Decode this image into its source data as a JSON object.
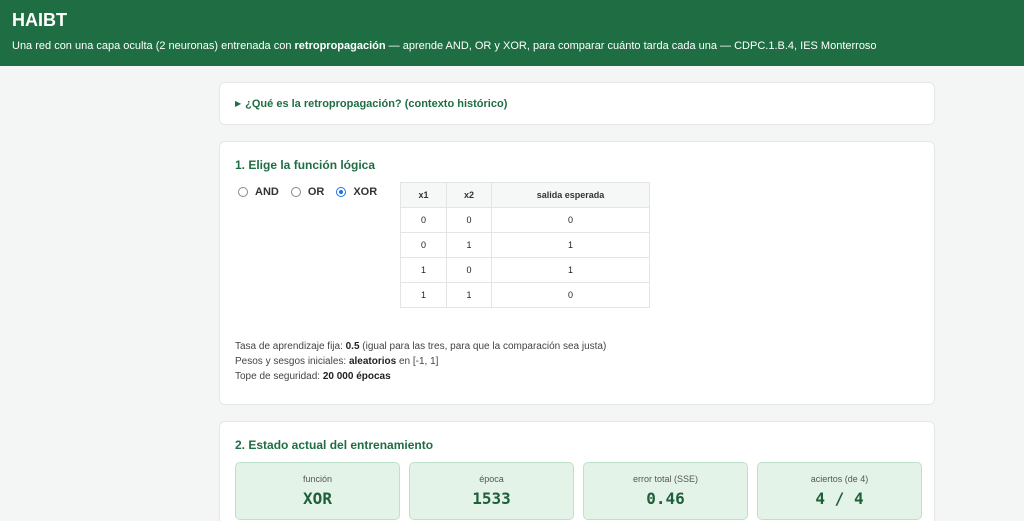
{
  "header": {
    "title": "HAIBT",
    "subtitle_pre": "Una red con una capa oculta (2 neuronas) entrenada con ",
    "subtitle_bold": "retropropagación",
    "subtitle_post": " — aprende AND, OR y XOR, para comparar cuánto tarda cada una — CDPC.1.B.4, IES Monterroso"
  },
  "context": {
    "summary": "¿Qué es la retropropagación? (contexto histórico)"
  },
  "section1": {
    "title": "1. Elige la función lógica",
    "options": [
      {
        "label": "AND",
        "selected": false
      },
      {
        "label": "OR",
        "selected": false
      },
      {
        "label": "XOR",
        "selected": true
      }
    ],
    "table": {
      "headers": [
        "x1",
        "x2",
        "salida esperada"
      ],
      "rows": [
        [
          "0",
          "0",
          "0"
        ],
        [
          "0",
          "1",
          "1"
        ],
        [
          "1",
          "0",
          "1"
        ],
        [
          "1",
          "1",
          "0"
        ]
      ]
    },
    "params": {
      "rate_pre": "Tasa de aprendizaje fija: ",
      "rate_val": "0.5",
      "rate_post": " (igual para las tres, para que la comparación sea justa)",
      "weights_pre": "Pesos y sesgos iniciales: ",
      "weights_val": "aleatorios",
      "weights_post": " en [-1, 1]",
      "cap_pre": "Tope de seguridad: ",
      "cap_val": "20 000 épocas"
    }
  },
  "section2": {
    "title": "2. Estado actual del entrenamiento",
    "stats": [
      {
        "label": "función",
        "value": "XOR"
      },
      {
        "label": "época",
        "value": "1533"
      },
      {
        "label": "error total (SSE)",
        "value": "0.46"
      },
      {
        "label": "aciertos (de 4)",
        "value": "4 / 4"
      }
    ]
  }
}
